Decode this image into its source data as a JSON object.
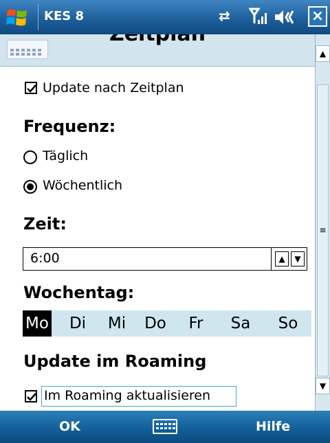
{
  "titlebar": {
    "app_title": "KES 8",
    "close_label": "×",
    "icons": [
      "windows-start-icon",
      "connectivity-icon",
      "signal-icon",
      "volume-icon"
    ]
  },
  "header": {
    "title": "Zeitplan"
  },
  "schedule": {
    "checkbox_label": "Update nach Zeitplan",
    "checked": true
  },
  "frequency": {
    "heading": "Frequenz:",
    "options": [
      {
        "label": "Täglich",
        "selected": false
      },
      {
        "label": "Wöchentlich",
        "selected": true
      }
    ]
  },
  "time": {
    "heading": "Zeit:",
    "value": "6:00",
    "up_glyph": "▲",
    "down_glyph": "▼"
  },
  "weekday": {
    "heading": "Wochentag:",
    "days": [
      "Mo",
      "Di",
      "Mi",
      "Do",
      "Fr",
      "Sa",
      "So"
    ],
    "selected": "Mo"
  },
  "roaming": {
    "heading": "Update im Roaming",
    "checkbox_label": "Im Roaming aktualisieren",
    "checked": true
  },
  "softkeys": {
    "left": "OK",
    "right": "Hilfe"
  },
  "colors": {
    "titlebar": "#1e5f9a",
    "accent_strip": "#cfe6ee",
    "softbar": "#125d96"
  }
}
